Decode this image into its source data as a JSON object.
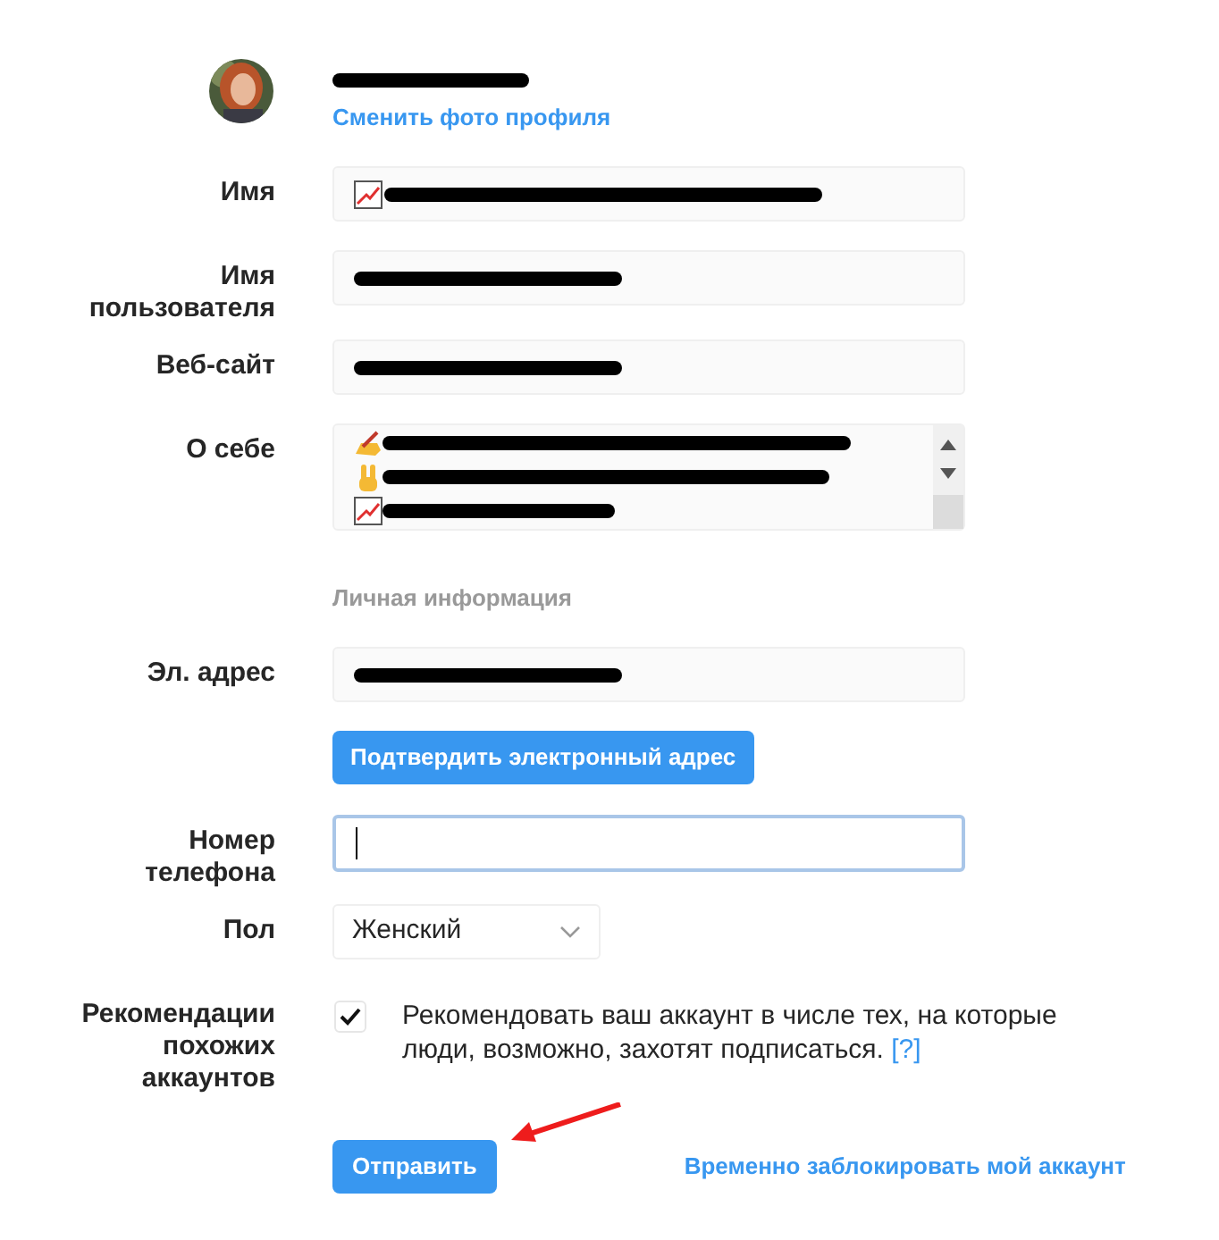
{
  "profile": {
    "username_redacted": true,
    "change_photo_link": "Сменить фото профиля"
  },
  "fields": [
    {
      "kind": "text",
      "label": "Имя",
      "redacted": true,
      "leading_icon": true
    },
    {
      "kind": "text",
      "label": "Имя пользователя",
      "redacted": true,
      "leading_icon": false
    },
    {
      "kind": "text",
      "label": "Веб-сайт",
      "redacted": true,
      "leading_icon": false
    },
    {
      "kind": "textarea",
      "label": "О себе",
      "lines": [
        {
          "redacted": true
        },
        {
          "redacted": true
        },
        {
          "redacted": true
        }
      ]
    },
    {
      "kind": "heading",
      "label": "Личная информация"
    },
    {
      "kind": "text",
      "label": "Эл. адрес",
      "redacted": true,
      "leading_icon": false
    },
    {
      "kind": "button",
      "label": "Подтвердить электронный адрес"
    },
    {
      "kind": "phone",
      "label": "Номер телефона",
      "focused": true
    },
    {
      "kind": "select",
      "label": "Пол",
      "value": "Женский"
    },
    {
      "kind": "checkbox",
      "label": "Рекомендации похожих аккаунтов",
      "checked": true,
      "text": "Рекомендовать ваш аккаунт в числе тех, на которые люди, возможно, захотят подписаться.",
      "help_link": "[?]"
    }
  ],
  "submit_button": "Отправить",
  "disable_link": "Временно заблокировать мой аккаунт"
}
